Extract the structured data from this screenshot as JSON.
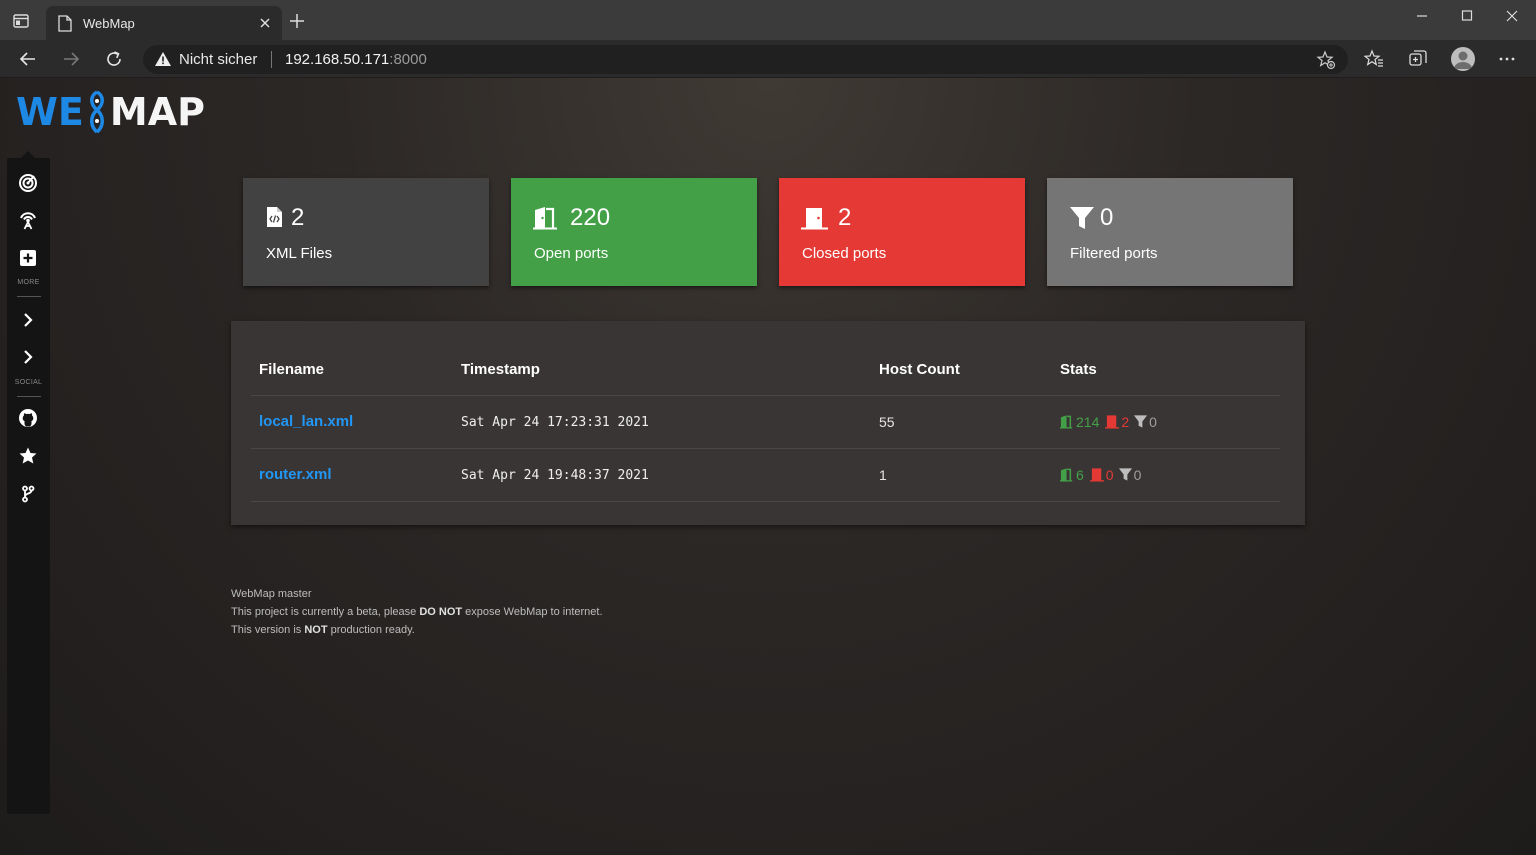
{
  "browser": {
    "tab_title": "WebMap",
    "security_label": "Nicht sicher",
    "url_host": "192.168.50.171",
    "url_port": ":8000"
  },
  "logo": {
    "part1": "WE",
    "part2": "MAP"
  },
  "sidebar": {
    "more_label": "MORE",
    "social_label": "SOCIAL"
  },
  "cards": {
    "xml_files": {
      "value": "2",
      "label": "XML Files"
    },
    "open_ports": {
      "value": "220",
      "label": "Open ports"
    },
    "closed_ports": {
      "value": "2",
      "label": "Closed ports"
    },
    "filtered_ports": {
      "value": "0",
      "label": "Filtered ports"
    }
  },
  "table": {
    "headers": [
      "Filename",
      "Timestamp",
      "Host Count",
      "Stats"
    ],
    "rows": [
      {
        "filename": "local_lan.xml",
        "timestamp": "Sat Apr 24 17:23:31 2021",
        "host_count": "55",
        "open": "214",
        "closed": "2",
        "filtered": "0"
      },
      {
        "filename": "router.xml",
        "timestamp": "Sat Apr 24 19:48:37 2021",
        "host_count": "1",
        "open": "6",
        "closed": "0",
        "filtered": "0"
      }
    ]
  },
  "footer": {
    "line1": "WebMap master",
    "line2_a": "This project is currently a beta, please ",
    "line2_b": "DO NOT",
    "line2_c": " expose WebMap to internet.",
    "line3_a": "This version is ",
    "line3_b": "NOT",
    "line3_c": " production ready."
  },
  "colors": {
    "accent_blue": "#2196f3",
    "open_green": "#43a047",
    "closed_red": "#e53935",
    "filtered_gray": "#757575"
  }
}
